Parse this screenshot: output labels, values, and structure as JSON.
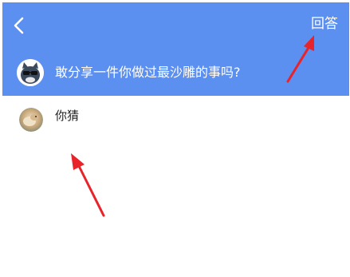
{
  "header": {
    "background_color": "#5b8ff0",
    "back_icon": "chevron-left-icon",
    "answer_label": "回答"
  },
  "question": {
    "avatar_icon": "cat-sunglasses-avatar",
    "text": "敢分享一件你做过最沙雕的事吗?"
  },
  "answer": {
    "avatar_icon": "user-photo-avatar",
    "text": "你猜"
  },
  "annotations": {
    "arrow_color": "#e8242a",
    "arrows": [
      "arrow-to-answer-button",
      "arrow-to-answer-text"
    ]
  }
}
